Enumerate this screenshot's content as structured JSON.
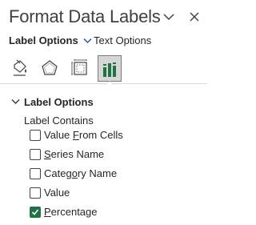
{
  "pane": {
    "title": "Format Data Labels",
    "dropdown_icon": "chevron-down-icon",
    "close_icon": "close-icon"
  },
  "tabs": {
    "label_options": "Label Options",
    "text_options": "Text Options"
  },
  "icon_tabs": [
    "fill-line-icon",
    "effects-icon",
    "size-properties-icon",
    "label-options-icon"
  ],
  "section": {
    "title": "Label Options",
    "subheading": "Label Contains"
  },
  "options": [
    {
      "pre": "Value ",
      "key": "F",
      "post": "rom Cells",
      "checked": false
    },
    {
      "pre": "",
      "key": "S",
      "post": "eries Name",
      "checked": false
    },
    {
      "pre": "Categ",
      "key": "o",
      "post": "ry Name",
      "checked": false
    },
    {
      "pre": "Value",
      "key": "",
      "post": "",
      "checked": false
    },
    {
      "pre": "",
      "key": "P",
      "post": "ercentage",
      "checked": true
    }
  ],
  "colors": {
    "accent_green": "#217346",
    "accent_blue": "#2b579a"
  }
}
